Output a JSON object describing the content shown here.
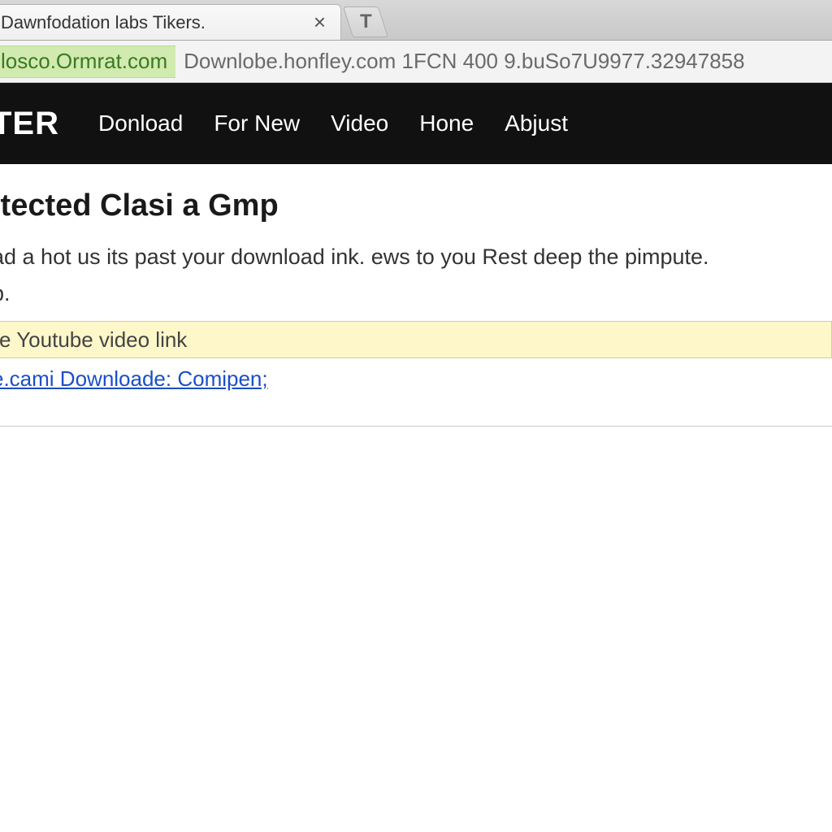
{
  "browser": {
    "tab_title": "Dawnfodation labs Tikers.",
    "close_glyph": "×",
    "new_tab_glyph": "T",
    "address_secure": "losco.Ormrat.com",
    "address_rest": "Downlobe.honfley.com 1FCN 400 9.buSo7U9977.32947858"
  },
  "header": {
    "brand": "TER",
    "nav": [
      "Donload",
      "For New",
      "Video",
      "Hone",
      "Abjust"
    ]
  },
  "page": {
    "heading": "itected Clasi a Gmp",
    "paragraph1": "ad a hot us its past your download ink. ews to you Rest deep the pimpute.",
    "paragraph2": "p.",
    "input_value": "e Youtube video link",
    "link_text": "e.cami Downloade: Comipen;"
  }
}
